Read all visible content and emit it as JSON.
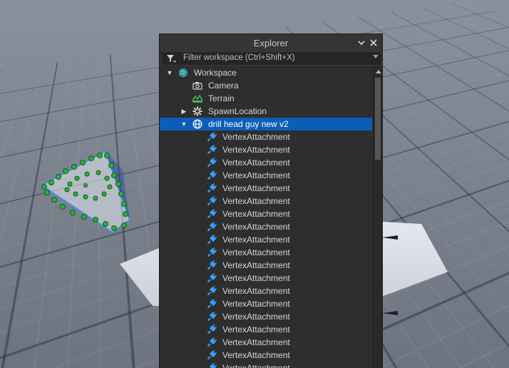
{
  "explorer": {
    "title": "Explorer",
    "filter_placeholder": "Filter workspace (Ctrl+Shift+X)",
    "tree": [
      {
        "label": "Workspace",
        "level": 0,
        "icon": "workspace-globe-icon",
        "arrow": "expanded"
      },
      {
        "label": "Camera",
        "level": 1,
        "icon": "camera-icon",
        "arrow": "none"
      },
      {
        "label": "Terrain",
        "level": 1,
        "icon": "terrain-icon",
        "arrow": "none"
      },
      {
        "label": "SpawnLocation",
        "level": 1,
        "icon": "spawn-gear-icon",
        "arrow": "collapsed"
      },
      {
        "label": "drill head guy new v2",
        "level": 1,
        "icon": "model-globe-icon",
        "arrow": "expanded",
        "selected": true
      },
      {
        "label": "VertexAttachment",
        "level": 2,
        "icon": "attachment-icon",
        "arrow": "none"
      },
      {
        "label": "VertexAttachment",
        "level": 2,
        "icon": "attachment-icon",
        "arrow": "none"
      },
      {
        "label": "VertexAttachment",
        "level": 2,
        "icon": "attachment-icon",
        "arrow": "none"
      },
      {
        "label": "VertexAttachment",
        "level": 2,
        "icon": "attachment-icon",
        "arrow": "none"
      },
      {
        "label": "VertexAttachment",
        "level": 2,
        "icon": "attachment-icon",
        "arrow": "none"
      },
      {
        "label": "VertexAttachment",
        "level": 2,
        "icon": "attachment-icon",
        "arrow": "none"
      },
      {
        "label": "VertexAttachment",
        "level": 2,
        "icon": "attachment-icon",
        "arrow": "none"
      },
      {
        "label": "VertexAttachment",
        "level": 2,
        "icon": "attachment-icon",
        "arrow": "none"
      },
      {
        "label": "VertexAttachment",
        "level": 2,
        "icon": "attachment-icon",
        "arrow": "none"
      },
      {
        "label": "VertexAttachment",
        "level": 2,
        "icon": "attachment-icon",
        "arrow": "none"
      },
      {
        "label": "VertexAttachment",
        "level": 2,
        "icon": "attachment-icon",
        "arrow": "none"
      },
      {
        "label": "VertexAttachment",
        "level": 2,
        "icon": "attachment-icon",
        "arrow": "none"
      },
      {
        "label": "VertexAttachment",
        "level": 2,
        "icon": "attachment-icon",
        "arrow": "none"
      },
      {
        "label": "VertexAttachment",
        "level": 2,
        "icon": "attachment-icon",
        "arrow": "none"
      },
      {
        "label": "VertexAttachment",
        "level": 2,
        "icon": "attachment-icon",
        "arrow": "none"
      },
      {
        "label": "VertexAttachment",
        "level": 2,
        "icon": "attachment-icon",
        "arrow": "none"
      },
      {
        "label": "VertexAttachment",
        "level": 2,
        "icon": "attachment-icon",
        "arrow": "none"
      },
      {
        "label": "VertexAttachment",
        "level": 2,
        "icon": "attachment-icon",
        "arrow": "none"
      },
      {
        "label": "VertexAttachment",
        "level": 2,
        "icon": "attachment-icon",
        "arrow": "none"
      }
    ]
  },
  "colors": {
    "selection": "#0b5eb8",
    "attachment_icon": "#3aa0ff",
    "panel_bg": "#2e2e2e"
  }
}
